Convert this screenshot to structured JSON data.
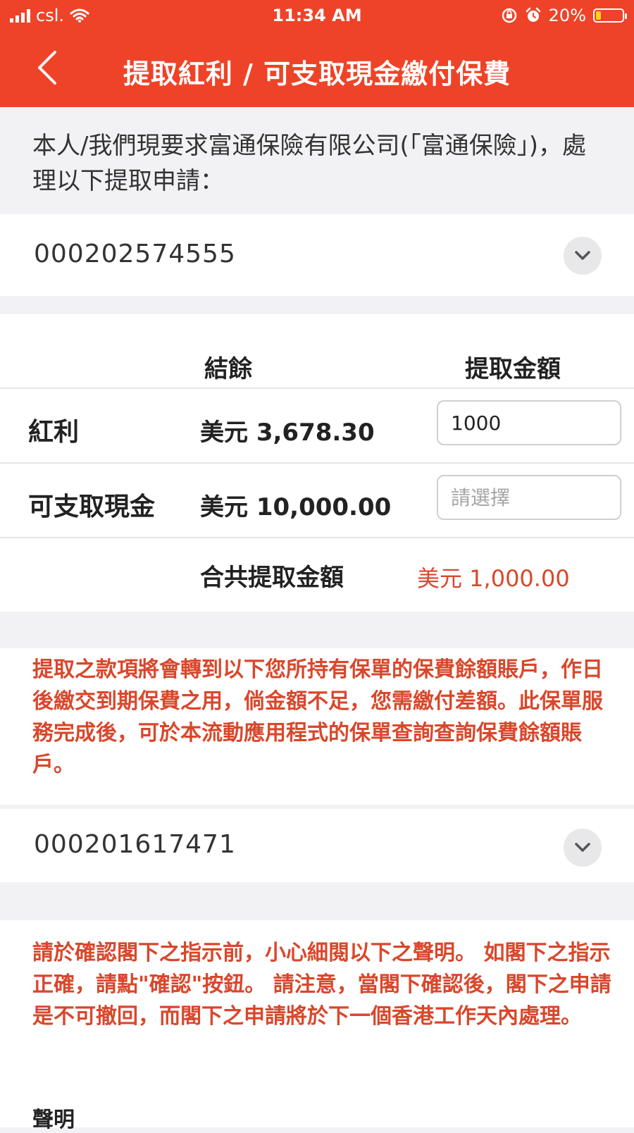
{
  "status_bar": {
    "carrier": "csl.",
    "time": "11:34 AM",
    "battery_pct": "20%",
    "battery_level": 0.2
  },
  "header": {
    "title": "提取紅利 / 可支取現金繳付保費"
  },
  "intro": {
    "text": "本人/我們現要求富通保險有限公司(「富通保險」)，處理以下提取申請："
  },
  "policy1": {
    "number": "000202574555"
  },
  "table": {
    "col_balance": "結餘",
    "col_withdraw": "提取金額",
    "rows": [
      {
        "label": "紅利",
        "balance": "美元 3,678.30",
        "input_value": "1000",
        "input_placeholder": ""
      },
      {
        "label": "可支取現金",
        "balance": "美元 10,000.00",
        "input_value": "",
        "input_placeholder": "請選擇"
      }
    ],
    "total_label": "合共提取金額",
    "total_value": "美元 1,000.00"
  },
  "notice1": {
    "text": "提取之款項將會轉到以下您所持有保單的保費餘額賬戶，作日後繳交到期保費之用，倘金額不足，您需繳付差額。此保單服務完成後，可於本流動應用程式的保單查詢查詢保費餘額賬戶。"
  },
  "policy2": {
    "number": "000201617471"
  },
  "notice2": {
    "text": "請於確認閣下之指示前，小心細閱以下之聲明。 如閣下之指示正確，請點\"確認\"按鈕。 請注意，當閣下確認後，閣下之申請是不可撤回，而閣下之申請將於下一個香港工作天內處理。",
    "declaration_title": "聲明"
  },
  "colors": {
    "brand": "#ee4328",
    "alert_text": "#d9472b",
    "background": "#f2f2f4"
  }
}
